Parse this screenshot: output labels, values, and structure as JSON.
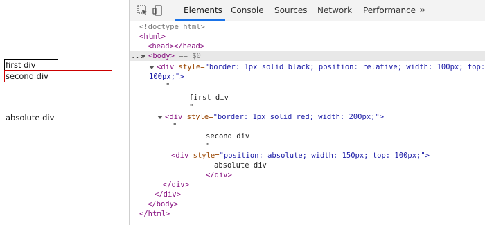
{
  "preview": {
    "first_text": "first div",
    "second_text": "second div",
    "absolute_text": "absolute div"
  },
  "devtools": {
    "tabs": [
      "Elements",
      "Console",
      "Sources",
      "Network",
      "Performance"
    ],
    "more": "»",
    "active_tab": "Elements"
  },
  "code": {
    "l1": "<!doctype html>",
    "l2_open": "<html>",
    "l3": "<head></head>",
    "l4_ellipsis": "...",
    "l4_body": "<body>",
    "l4_eq": "== $0",
    "l5_tag_open": "<div",
    "l5_attr": "style=",
    "l5_val": "\"border: 1px solid black; position: relative; width: 100px; top:",
    "l6_val": "100px;\">",
    "l7_quote": "\"",
    "l8_text": "first div",
    "l9_quote": "\"",
    "l10_tag_open": "<div",
    "l10_attr": "style=",
    "l10_val": "\"border: 1px solid red; width: 200px;\">",
    "l11_quote": "\"",
    "l12_text": "second div",
    "l13_quote": "\"",
    "l14_tag_open": "<div",
    "l14_attr": "style=",
    "l14_val": "\"position: absolute; width: 150px; top: 100px;\">",
    "l15_text": "absolute div",
    "l16_close": "</div>",
    "l17_close": "</div>",
    "l18_close": "</div>",
    "l19_close": "</body>",
    "l20_close": "</html>"
  }
}
